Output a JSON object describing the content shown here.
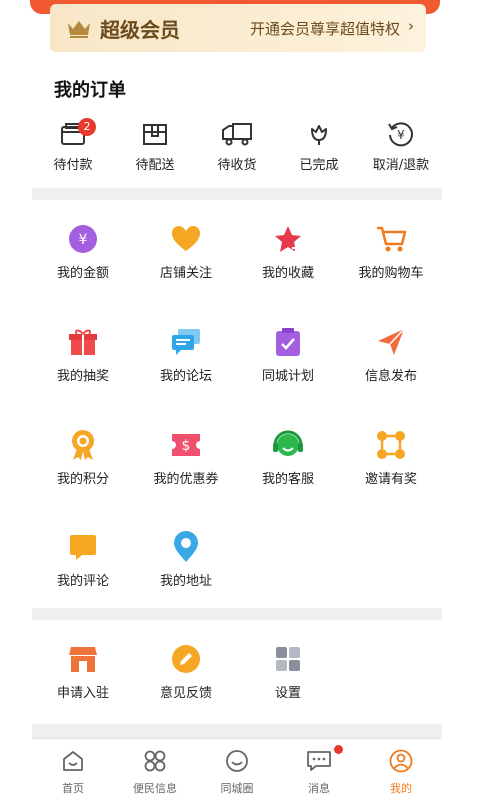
{
  "vip": {
    "title": "超级会员",
    "subtitle": "开通会员尊享超值特权",
    "arrow": "›"
  },
  "orders": {
    "title": "我的订单",
    "items": [
      {
        "label": "待付款",
        "icon": "wallet-icon",
        "badge": "2"
      },
      {
        "label": "待配送",
        "icon": "package-icon"
      },
      {
        "label": "待收货",
        "icon": "truck-icon"
      },
      {
        "label": "已完成",
        "icon": "flower-icon"
      },
      {
        "label": "取消/退款",
        "icon": "refund-icon"
      }
    ]
  },
  "services": [
    {
      "label": "我的金额",
      "icon": "money-icon"
    },
    {
      "label": "店铺关注",
      "icon": "heart-icon"
    },
    {
      "label": "我的收藏",
      "icon": "star-icon"
    },
    {
      "label": "我的购物车",
      "icon": "cart-icon"
    },
    {
      "label": "我的抽奖",
      "icon": "gift-icon"
    },
    {
      "label": "我的论坛",
      "icon": "chat-icon"
    },
    {
      "label": "同城计划",
      "icon": "clipboard-icon"
    },
    {
      "label": "信息发布",
      "icon": "send-icon"
    },
    {
      "label": "我的积分",
      "icon": "medal-icon"
    },
    {
      "label": "我的优惠券",
      "icon": "coupon-icon"
    },
    {
      "label": "我的客服",
      "icon": "headset-icon"
    },
    {
      "label": "邀请有奖",
      "icon": "network-icon"
    },
    {
      "label": "我的评论",
      "icon": "comment-icon"
    },
    {
      "label": "我的地址",
      "icon": "location-icon"
    }
  ],
  "extras": [
    {
      "label": "申请入驻",
      "icon": "store-icon"
    },
    {
      "label": "意见反馈",
      "icon": "pencil-icon"
    },
    {
      "label": "设置",
      "icon": "settings-icon"
    }
  ],
  "tabbar": [
    {
      "label": "首页",
      "icon": "home-icon"
    },
    {
      "label": "便民信息",
      "icon": "grid-icon"
    },
    {
      "label": "同城圈",
      "icon": "smile-icon"
    },
    {
      "label": "消息",
      "icon": "message-icon"
    },
    {
      "label": "我的",
      "icon": "profile-icon"
    }
  ],
  "colors": {
    "accent": "#f07b1d",
    "badge": "#e8392c",
    "brand_strip": "#f15a30"
  }
}
